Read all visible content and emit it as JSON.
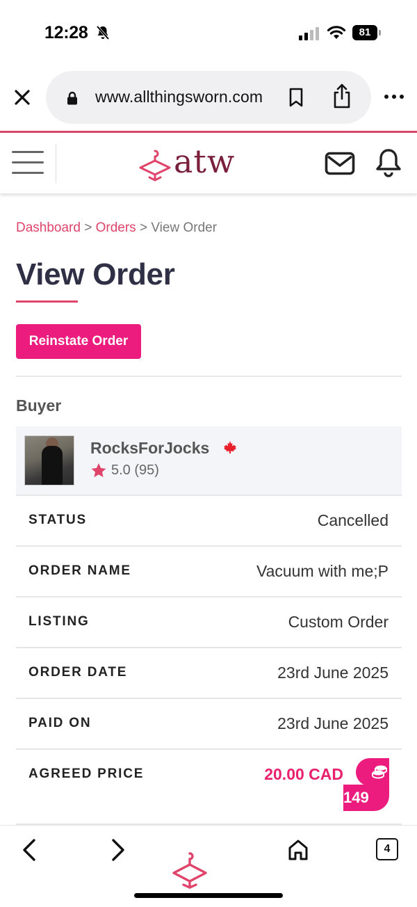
{
  "status_bar": {
    "time": "12:28",
    "battery": "81"
  },
  "browser": {
    "url": "www.allthingsworn.com",
    "tab_count": "4"
  },
  "site": {
    "logo_text": "atw",
    "accent_color": "#e0446b",
    "button_color": "#ec1b7e"
  },
  "breadcrumb": {
    "dashboard": "Dashboard",
    "sep1": " > ",
    "orders": "Orders",
    "sep2": " > ",
    "current": "View Order"
  },
  "page": {
    "title": "View Order",
    "reinstate_label": "Reinstate Order"
  },
  "buyer": {
    "section_label": "Buyer",
    "name": "RocksForJocks",
    "country_flag": "canada-flag",
    "rating": "5.0",
    "review_count": "(95)"
  },
  "details": [
    {
      "label": "STATUS",
      "value": "Cancelled"
    },
    {
      "label": "ORDER NAME",
      "value": "Vacuum with me;P"
    },
    {
      "label": "LISTING",
      "value": "Custom Order"
    },
    {
      "label": "ORDER DATE",
      "value": "23rd June 2025"
    },
    {
      "label": "PAID ON",
      "value": "23rd June 2025"
    },
    {
      "label": "AGREED PRICE",
      "value": "20.00 CAD"
    }
  ],
  "coins": {
    "count": "149"
  }
}
